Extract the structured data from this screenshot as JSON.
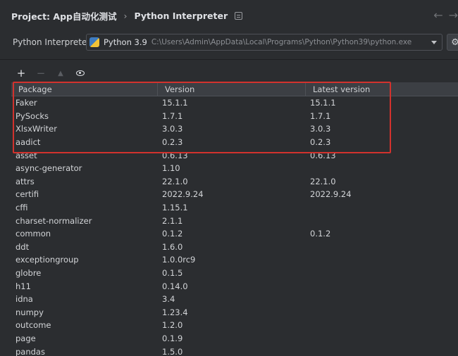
{
  "header": {
    "project": "Project: App自动化测试",
    "separator": "›",
    "title": "Python Interpreter",
    "back_icon": "←",
    "forward_icon": "→"
  },
  "interpreter": {
    "label": "Python Interpreter:",
    "name": "Python 3.9",
    "path": "C:\\Users\\Admin\\AppData\\Local\\Programs\\Python\\Python39\\python.exe"
  },
  "toolbar": {
    "add": "+",
    "remove": "−",
    "up": "▲"
  },
  "table": {
    "columns": [
      "Package",
      "Version",
      "Latest version"
    ],
    "rows": [
      {
        "package": "Faker",
        "version": "15.1.1",
        "latest": "15.1.1"
      },
      {
        "package": "PySocks",
        "version": "1.7.1",
        "latest": "1.7.1"
      },
      {
        "package": "XlsxWriter",
        "version": "3.0.3",
        "latest": "3.0.3"
      },
      {
        "package": "aadict",
        "version": "0.2.3",
        "latest": "0.2.3"
      },
      {
        "package": "asset",
        "version": "0.6.13",
        "latest": "0.6.13"
      },
      {
        "package": "async-generator",
        "version": "1.10",
        "latest": ""
      },
      {
        "package": "attrs",
        "version": "22.1.0",
        "latest": "22.1.0"
      },
      {
        "package": "certifi",
        "version": "2022.9.24",
        "latest": "2022.9.24"
      },
      {
        "package": "cffi",
        "version": "1.15.1",
        "latest": ""
      },
      {
        "package": "charset-normalizer",
        "version": "2.1.1",
        "latest": ""
      },
      {
        "package": "common",
        "version": "0.1.2",
        "latest": "0.1.2"
      },
      {
        "package": "ddt",
        "version": "1.6.0",
        "latest": ""
      },
      {
        "package": "exceptiongroup",
        "version": "1.0.0rc9",
        "latest": ""
      },
      {
        "package": "globre",
        "version": "0.1.5",
        "latest": ""
      },
      {
        "package": "h11",
        "version": "0.14.0",
        "latest": ""
      },
      {
        "package": "idna",
        "version": "3.4",
        "latest": ""
      },
      {
        "package": "numpy",
        "version": "1.23.4",
        "latest": ""
      },
      {
        "package": "outcome",
        "version": "1.2.0",
        "latest": ""
      },
      {
        "package": "page",
        "version": "0.1.9",
        "latest": ""
      },
      {
        "package": "pandas",
        "version": "1.5.0",
        "latest": ""
      }
    ]
  },
  "colors": {
    "background": "#2b2d30",
    "highlight": "#d2322d",
    "header_bg": "#3c3f44"
  }
}
